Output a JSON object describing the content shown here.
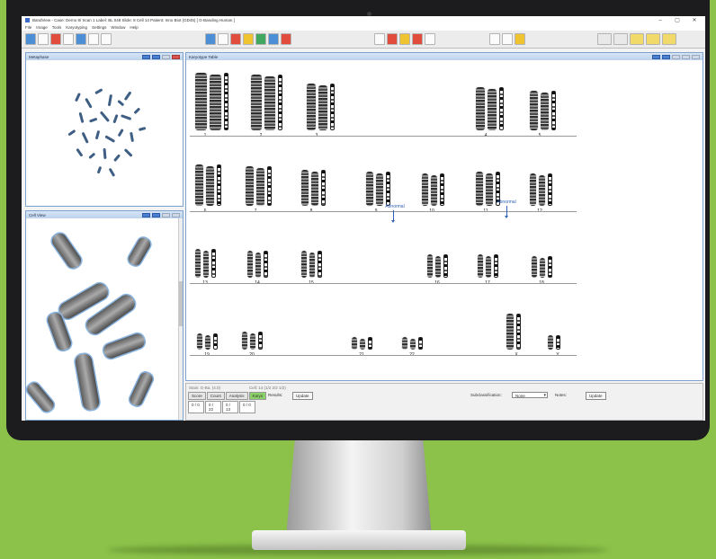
{
  "window": {
    "title": "BandView - Case: Demo 8/ Scan 1 Label: BL 048 Slide: 8 Cell 14   Patient: Inno Biot (GD45)  [ G-Banding Human ]",
    "minimize": "–",
    "maximize": "▢",
    "close": "✕"
  },
  "menu": [
    "File",
    "Image",
    "Tools",
    "Karyotyping",
    "Settings",
    "Window",
    "Help"
  ],
  "panels": {
    "metaphase": "Metaphase",
    "cell": "Cell View",
    "karyotype": "Karyotype Table"
  },
  "chromosomes": [
    "1",
    "2",
    "3",
    "4",
    "5",
    "6",
    "7",
    "8",
    "9",
    "10",
    "11",
    "12",
    "13",
    "14",
    "15",
    "16",
    "17",
    "18",
    "19",
    "20",
    "21",
    "22",
    "X",
    "Y"
  ],
  "annotations": [
    {
      "label": "Abnormal",
      "chromosome": "9"
    },
    {
      "label": "Abnormal",
      "chromosome": "11"
    }
  ],
  "bottom": {
    "info_left": "Stain: G-Ba. (4.0)",
    "info_right": "Cell: 14  (1/2 2/2 1/2)",
    "tabs": [
      "Score",
      "Count",
      "Analysis",
      "Karyo"
    ],
    "active_tab": "Karyo",
    "results_label": "Results:",
    "update_label": "Update",
    "values": [
      "0 / 0",
      "0 / 22",
      "0 / 13",
      "0 / 0"
    ],
    "subclass_label": "Subclassification:",
    "subclass_value": "None",
    "notes_label": "Notes:",
    "notes_update": "Update"
  },
  "colors": {
    "accent": "#4b7fd0",
    "abnormal": "#2f62b8",
    "active_tab": "#8bd16a",
    "background": "#8cc24a"
  }
}
